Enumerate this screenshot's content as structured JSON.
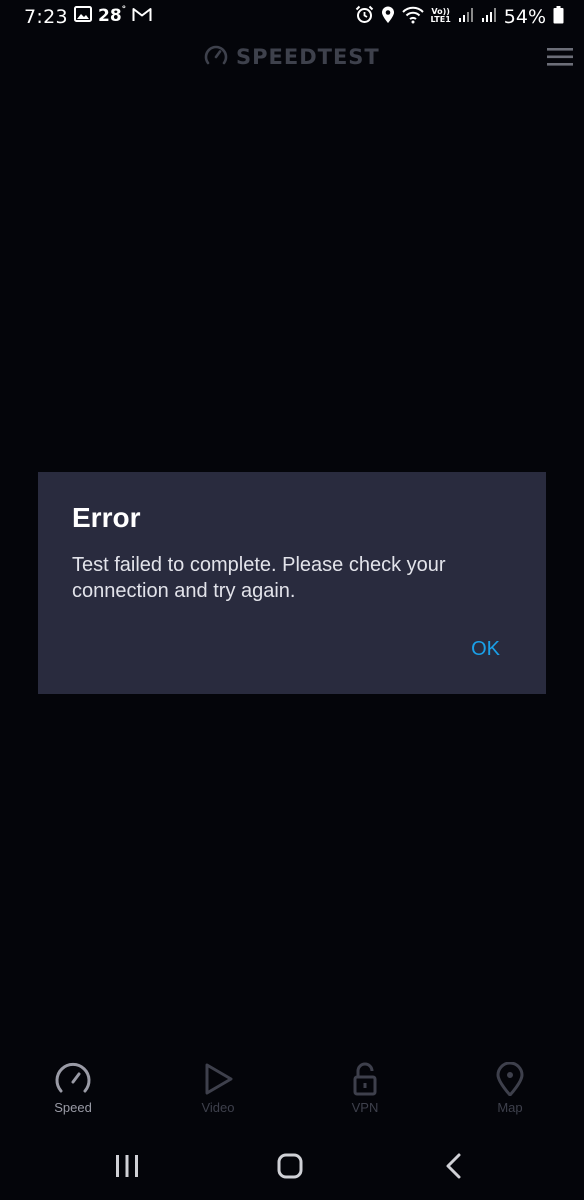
{
  "status_bar": {
    "time": "7:23",
    "temperature": "28",
    "temperature_unit": "°",
    "volte_top": "Vo))",
    "volte_bottom": "LTE1",
    "battery_percent": "54%",
    "icons": [
      "gallery-icon",
      "gmail-icon",
      "alarm-icon",
      "location-icon",
      "wifi-icon",
      "signal-icon",
      "signal-icon-2",
      "battery-icon"
    ]
  },
  "header": {
    "brand": "SPEEDTEST",
    "brand_icon": "speedometer-icon",
    "menu_icon": "hamburger-menu-icon"
  },
  "dialog": {
    "title": "Error",
    "message": "Test failed to complete. Please check your connection and try again.",
    "ok_label": "OK"
  },
  "tabs": [
    {
      "label": "Speed",
      "icon": "speedometer-icon",
      "active": true
    },
    {
      "label": "Video",
      "icon": "play-icon",
      "active": false
    },
    {
      "label": "VPN",
      "icon": "unlock-icon",
      "active": false
    },
    {
      "label": "Map",
      "icon": "map-pin-icon",
      "active": false
    }
  ],
  "navigation": {
    "recents_icon": "recents-icon",
    "home_icon": "home-icon",
    "back_icon": "back-icon"
  },
  "colors": {
    "background": "#04050a",
    "dialog_background": "#292b3e",
    "accent": "#1aa0e8",
    "inactive": "#3e404c",
    "active_tab": "#9a9ba6"
  }
}
